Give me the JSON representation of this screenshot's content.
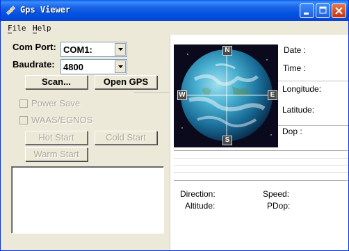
{
  "window": {
    "title": "Gps Viewer"
  },
  "menu": {
    "file": "File",
    "help": "Help"
  },
  "settings": {
    "com_port_label": "Com Port:",
    "com_port_value": "COM1:",
    "baudrate_label": "Baudrate:",
    "baudrate_value": "4800"
  },
  "buttons": {
    "scan": "Scan...",
    "open_gps": "Open GPS",
    "hot_start": "Hot Start",
    "cold_start": "Cold Start",
    "warm_start": "Warm Start"
  },
  "checkboxes": {
    "power_save": "Power Save",
    "waas_egnos": "WAAS/EGNOS"
  },
  "compass": {
    "north": "N",
    "south": "S",
    "east": "E",
    "west": "W"
  },
  "info": {
    "date": "Date :",
    "time": "Time :",
    "longitude": "Longitude:",
    "latitude": "Latitude:",
    "dop": "Dop :",
    "direction": "Direction:",
    "speed": "Speed:",
    "altitude": "Altitude:",
    "pdop": "PDop:"
  },
  "colors": {
    "title_bar": "#0a5ef0",
    "window_bg": "#ece9d8",
    "close_button": "#c63210"
  }
}
